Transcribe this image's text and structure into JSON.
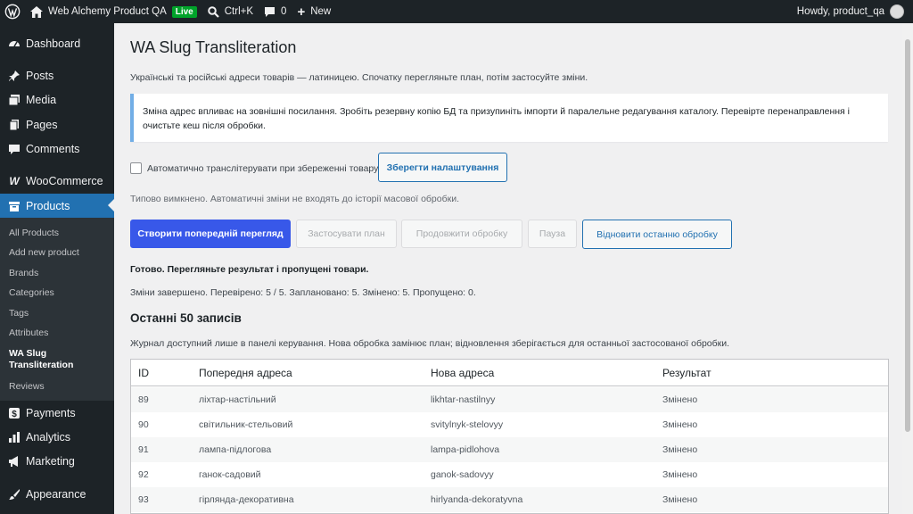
{
  "admin_bar": {
    "site_name": "Web Alchemy Product QA",
    "live_badge": "Live",
    "shortcut": "Ctrl+K",
    "comments_count": "0",
    "new_label": "New",
    "howdy": "Howdy, product_qa"
  },
  "sidebar": {
    "menu": [
      {
        "label": "Dashboard",
        "icon": "dashboard-icon"
      },
      {
        "label": "Posts",
        "icon": "pin-icon"
      },
      {
        "label": "Media",
        "icon": "media-icon"
      },
      {
        "label": "Pages",
        "icon": "pages-icon"
      },
      {
        "label": "Comments",
        "icon": "comment-icon"
      },
      {
        "label": "WooCommerce",
        "icon": "woo-icon"
      },
      {
        "label": "Products",
        "icon": "archive-icon"
      },
      {
        "label": "Payments",
        "icon": "dollar-icon"
      },
      {
        "label": "Analytics",
        "icon": "chart-icon"
      },
      {
        "label": "Marketing",
        "icon": "megaphone-icon"
      },
      {
        "label": "Appearance",
        "icon": "brush-icon"
      }
    ],
    "submenu": [
      "All Products",
      "Add new product",
      "Brands",
      "Categories",
      "Tags",
      "Attributes",
      "WA Slug Transliteration",
      "Reviews"
    ]
  },
  "page": {
    "title": "WA Slug Transliteration",
    "intro": "Українські та російські адреси товарів — латиницею. Спочатку перегляньте план, потім застосуйте зміни.",
    "notice": "Зміна адрес впливає на зовнішні посилання. Зробіть резервну копію БД та призупиніть імпорти й паралельне редагування каталогу. Перевірте перенаправлення і очистьте кеш після обробки.",
    "auto_checkbox_label": "Автоматично транслітерувати при збереженні товару",
    "auto_checkbox_checked": false,
    "save_settings": "Зберегти налаштування",
    "auto_hint": "Типово вимкнено. Автоматичні зміни не входять до історії масової обробки.",
    "buttons": {
      "preview": "Створити попередній перегляд",
      "apply": "Застосувати план",
      "continue": "Продовжити обробку",
      "pause": "Пауза",
      "restore": "Відновити останню обробку"
    },
    "status_bold": "Готово. Перегляньте результат і пропущені товари.",
    "status_detail": "Зміни завершено. Перевірено: 5 / 5. Заплановано: 5. Змінено: 5. Пропущено: 0.",
    "log_heading": "Останні 50 записів",
    "log_note": "Журнал доступний лише в панелі керування. Нова обробка замінює план; відновлення зберігається для останньої застосованої обробки.",
    "table": {
      "headers": [
        "ID",
        "Попередня адреса",
        "Нова адреса",
        "Результат"
      ],
      "rows": [
        [
          "89",
          "ліхтар-настільний",
          "likhtar-nastilnyy",
          "Змінено"
        ],
        [
          "90",
          "світильник-стельовий",
          "svitylnyk-stelovyy",
          "Змінено"
        ],
        [
          "91",
          "лампа-підлогова",
          "lampa-pidlohova",
          "Змінено"
        ],
        [
          "92",
          "ганок-садовий",
          "ganok-sadovyy",
          "Змінено"
        ],
        [
          "93",
          "гірлянда-декоративна",
          "hirlyanda-dekoratyvna",
          "Змінено"
        ]
      ]
    }
  },
  "colors": {
    "admin_bg": "#1d2327",
    "accent": "#2271b1",
    "primary_button": "#3858e9",
    "notice_border": "#72aee6"
  }
}
